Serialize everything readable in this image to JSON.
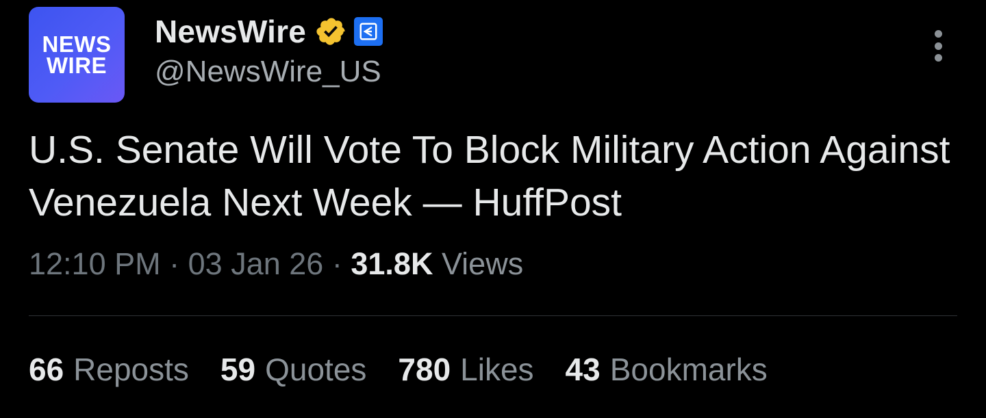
{
  "header": {
    "avatar_lines": [
      "NEWS",
      "WIRE"
    ],
    "display_name": "NewsWire",
    "handle": "@NewsWire_US",
    "verified_color": "#f4c330",
    "affiliate_color": "#1d6ff2",
    "more_icon": "more-vertical-icon"
  },
  "tweet": {
    "text": "U.S. Senate Will Vote To Block Military Action Against Venezuela Next Week — HuffPost",
    "time": "12:10 PM",
    "sep1": "·",
    "date": "03 Jan 26",
    "sep2": "·",
    "views_count": "31.8K",
    "views_label": "Views"
  },
  "stats": [
    {
      "count": "66",
      "label": "Reposts"
    },
    {
      "count": "59",
      "label": "Quotes"
    },
    {
      "count": "780",
      "label": "Likes"
    },
    {
      "count": "43",
      "label": "Bookmarks"
    }
  ]
}
